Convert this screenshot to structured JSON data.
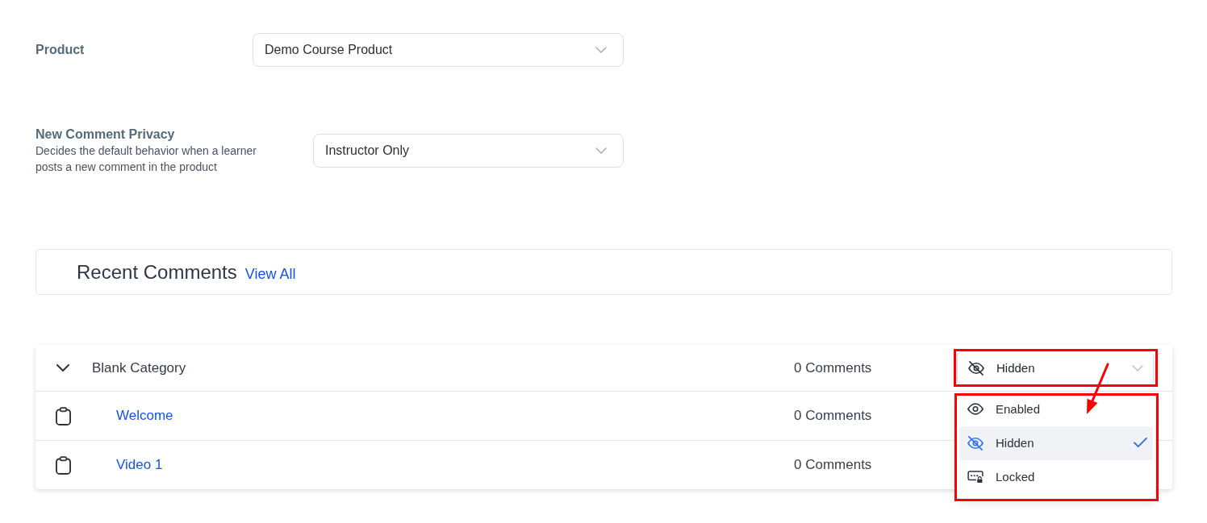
{
  "settings": [
    {
      "label": "Product",
      "select": {
        "value": "Demo Course Product"
      }
    },
    {
      "label": "New Comment Privacy",
      "description": "Decides the default behavior when a learner posts a new comment in the product",
      "select": {
        "value": "Instructor Only"
      }
    }
  ],
  "recent_comments": {
    "title": "Recent Comments",
    "link": "View All"
  },
  "table": {
    "category": {
      "name": "Blank Category",
      "expanded": true,
      "count": "0 Comments",
      "visibility": {
        "value": "Hidden",
        "kind": "hidden",
        "open": true,
        "outlined": true,
        "menu_outlined": true,
        "arrow": true,
        "options": [
          {
            "label": "Enabled",
            "kind": "enabled",
            "selected": false
          },
          {
            "label": "Hidden",
            "kind": "hidden",
            "selected": true
          },
          {
            "label": "Locked",
            "kind": "locked",
            "selected": false
          }
        ]
      },
      "children": [
        {
          "title": "Welcome",
          "count": "0 Comments"
        },
        {
          "title": "Video 1",
          "count": "0 Comments"
        }
      ]
    }
  }
}
